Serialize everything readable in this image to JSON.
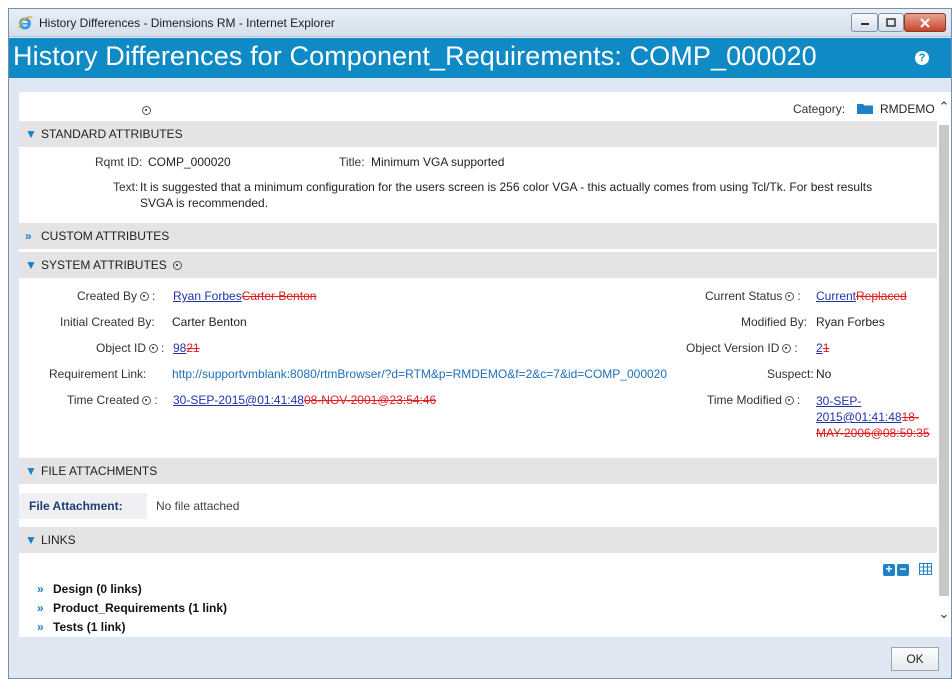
{
  "window": {
    "title": "History Differences - Dimensions RM - Internet Explorer"
  },
  "header": {
    "title": "History Differences for Component_Requirements: COMP_000020",
    "help_glyph": "?"
  },
  "top": {
    "category_label": "Category:",
    "category_value": "RMDEMO"
  },
  "sections": {
    "standard": "STANDARD ATTRIBUTES",
    "custom": "CUSTOM ATTRIBUTES",
    "system": "SYSTEM ATTRIBUTES",
    "files": "FILE ATTACHMENTS",
    "links": "LINKS"
  },
  "standard": {
    "rqmt_id_label": "Rqmt ID:",
    "rqmt_id": "COMP_000020",
    "title_label": "Title:",
    "title": "Minimum VGA supported",
    "text_label": "Text:",
    "text_line1": "It is suggested that a minimum configuration for the users screen is 256 color VGA - this actually comes from using Tcl/Tk. For best results",
    "text_line2": "SVGA is recommended."
  },
  "system": {
    "created_by_label": "Created By",
    "created_by_new": "Ryan Forbes",
    "created_by_old": "Carter Benton",
    "initial_created_by_label": "Initial Created By:",
    "initial_created_by": "Carter Benton",
    "object_id_label": "Object ID",
    "object_id_new": "98",
    "object_id_old": "21",
    "req_link_label": "Requirement Link:",
    "req_link": "http://supportvmblank:8080/rtmBrowser/?d=RTM&p=RMDEMO&f=2&c=7&id=COMP_000020",
    "time_created_label": "Time Created",
    "time_created_new": "30-SEP-2015@01:41:48",
    "time_created_old": "08-NOV-2001@23:54:46",
    "current_status_label": "Current Status",
    "current_status_new": "Current",
    "current_status_old": "Replaced",
    "modified_by_label": "Modified By:",
    "modified_by": "Ryan Forbes",
    "object_version_label": "Object Version ID",
    "object_version_new": "2",
    "object_version_old": "1",
    "suspect_label": "Suspect:",
    "suspect": "No",
    "time_modified_label": "Time Modified",
    "time_modified_new_1": "30-SEP-",
    "time_modified_new_2": "2015@01:41:48",
    "time_modified_old_2": "18-",
    "time_modified_old_3": "MAY-2006@08:59:35"
  },
  "files": {
    "label": "File Attachment:",
    "value": "No file attached"
  },
  "links": {
    "groups": [
      "Design (0 links)",
      "Product_Requirements (1 link)",
      "Tests (1 link)"
    ]
  },
  "buttons": {
    "ok": "OK"
  },
  "colors": {
    "header": "#0f8ac4",
    "deleted": "#e02020",
    "inserted_link": "#2233aa"
  }
}
